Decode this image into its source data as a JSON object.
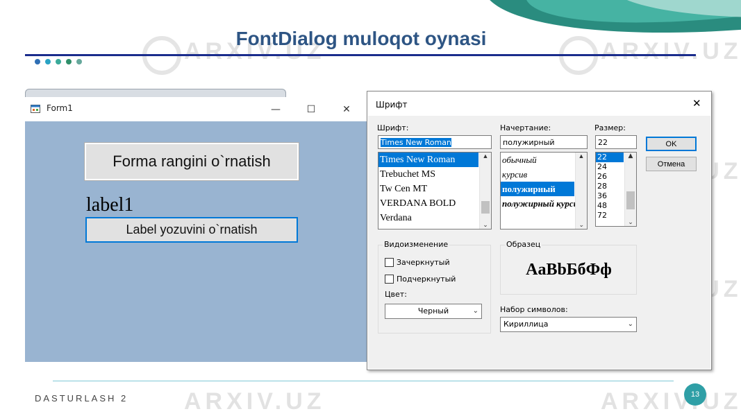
{
  "slide": {
    "title": "FontDialog muloqot oynasi",
    "footer": "DASTURLASH 2",
    "page_number": "13",
    "watermark": "ARXIV.UZ",
    "dot_colors": [
      "#2f6fb5",
      "#2aa3c4",
      "#3aaa9a",
      "#2f8f6a",
      "#66a89c"
    ]
  },
  "form1": {
    "title": "Form1",
    "minimize_glyph": "—",
    "maximize_glyph": "☐",
    "close_glyph": "✕",
    "button_forma": "Forma rangini o`rnatish",
    "label1": "label1",
    "button_label": "Label yozuvini o`rnatish",
    "background_color": "#99b4d1"
  },
  "dialog": {
    "title": "Шрифт",
    "close_glyph": "✕",
    "font": {
      "caption": "Шрифт:",
      "value": "Times New Roman",
      "items": [
        "Times New Roman",
        "Trebuchet MS",
        "Tw Cen MT",
        "VERDANA BOLD",
        "Verdana"
      ],
      "selected_index": 0
    },
    "style": {
      "caption": "Начертание:",
      "value": "полужирный",
      "items": [
        "обычный",
        "курсив",
        "полужирный",
        "полужирный курсив"
      ],
      "selected_index": 2
    },
    "size": {
      "caption": "Размер:",
      "value": "22",
      "items": [
        "22",
        "24",
        "26",
        "28",
        "36",
        "48",
        "72"
      ],
      "selected_index": 0
    },
    "ok_button": "OK",
    "cancel_button": "Отмена",
    "effects": {
      "caption": "Видоизменение",
      "strikeout_label": "Зачеркнутый",
      "strikeout_checked": false,
      "underline_label": "Подчеркнутый",
      "underline_checked": false,
      "color_caption": "Цвет:",
      "color_value": "Черный"
    },
    "sample": {
      "caption": "Образец",
      "text": "AaBbБбФф"
    },
    "charset": {
      "caption": "Набор символов:",
      "value": "Кириллица"
    }
  }
}
